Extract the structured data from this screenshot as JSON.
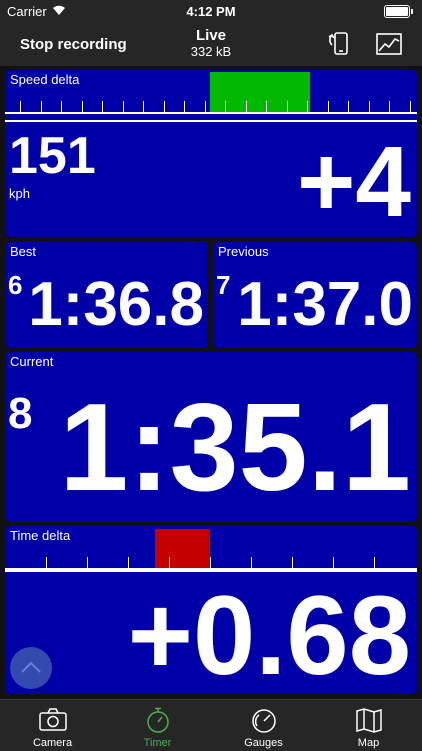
{
  "status_bar": {
    "carrier": "Carrier",
    "time": "4:12 PM"
  },
  "header": {
    "stop_label": "Stop recording",
    "title": "Live",
    "subtitle": "332 kB"
  },
  "panels": {
    "speed_delta": {
      "label": "Speed delta",
      "speed": "151",
      "unit": "kph",
      "delta": "+4"
    },
    "best": {
      "label": "Best",
      "lap": "6",
      "time": "1:36.8"
    },
    "previous": {
      "label": "Previous",
      "lap": "7",
      "time": "1:37.0"
    },
    "current": {
      "label": "Current",
      "lap": "8",
      "time": "1:35.1"
    },
    "time_delta": {
      "label": "Time delta",
      "delta": "+0.68"
    }
  },
  "colors": {
    "panel_bg": "#0000a8",
    "speed_bar": "#00b900",
    "time_bar": "#c40000",
    "tab_active": "#4caf50"
  },
  "tabs": [
    {
      "label": "Camera",
      "icon": "camera-icon",
      "active": false
    },
    {
      "label": "Timer",
      "icon": "stopwatch-icon",
      "active": true
    },
    {
      "label": "Gauges",
      "icon": "gauge-icon",
      "active": false
    },
    {
      "label": "Map",
      "icon": "map-icon",
      "active": false
    }
  ]
}
